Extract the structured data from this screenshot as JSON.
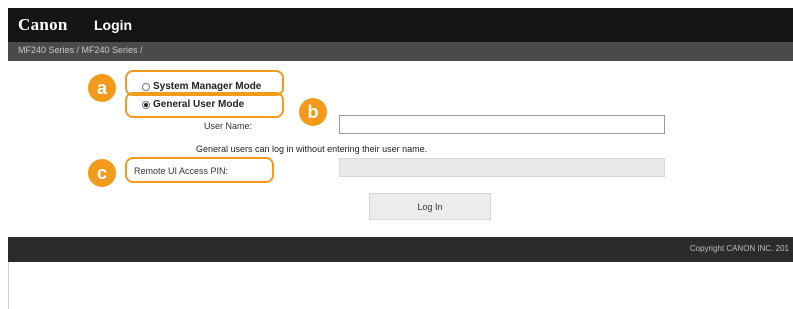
{
  "header": {
    "logo": "Canon",
    "title": "Login"
  },
  "breadcrumb": "MF240 Series / MF240 Series /",
  "login": {
    "system_manager_mode": "System Manager Mode",
    "general_user_mode": "General User Mode",
    "selected_mode": "General User Mode",
    "user_name_label": "User Name:",
    "user_name_value": "",
    "hint": "General users can log in without entering their user name.",
    "pin_label": "Remote UI Access PIN:",
    "pin_value": "",
    "login_button": "Log In"
  },
  "callouts": {
    "a": "a",
    "b": "b",
    "c": "c"
  },
  "footer": {
    "copyright": "Copyright CANON INC. 201"
  },
  "colors": {
    "callout": "#f39a1b",
    "header_bg": "#151515",
    "breadcrumb_bg": "#4a4a4a",
    "footer_bg": "#2b2b2b"
  }
}
